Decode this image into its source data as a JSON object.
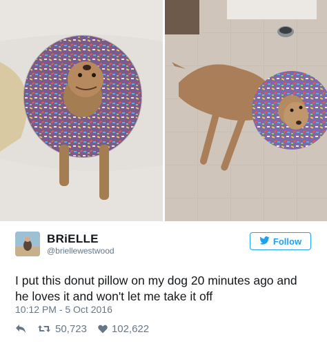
{
  "tweet": {
    "display_name": "BRiELLE",
    "handle": "@briellewestwood",
    "follow_label": "Follow",
    "text": "I put this donut pillow on my dog 20 minutes ago and he loves it and won't let me take it off",
    "timestamp": "10:12 PM - 5 Oct 2016",
    "retweet_count": "50,723",
    "like_count": "102,622"
  },
  "icons": {
    "follow": "bird-icon",
    "reply": "reply-icon",
    "retweet": "retweet-icon",
    "like": "heart-icon"
  },
  "colors": {
    "accent": "#1da1f2",
    "muted": "#657786",
    "text": "#14171a"
  }
}
